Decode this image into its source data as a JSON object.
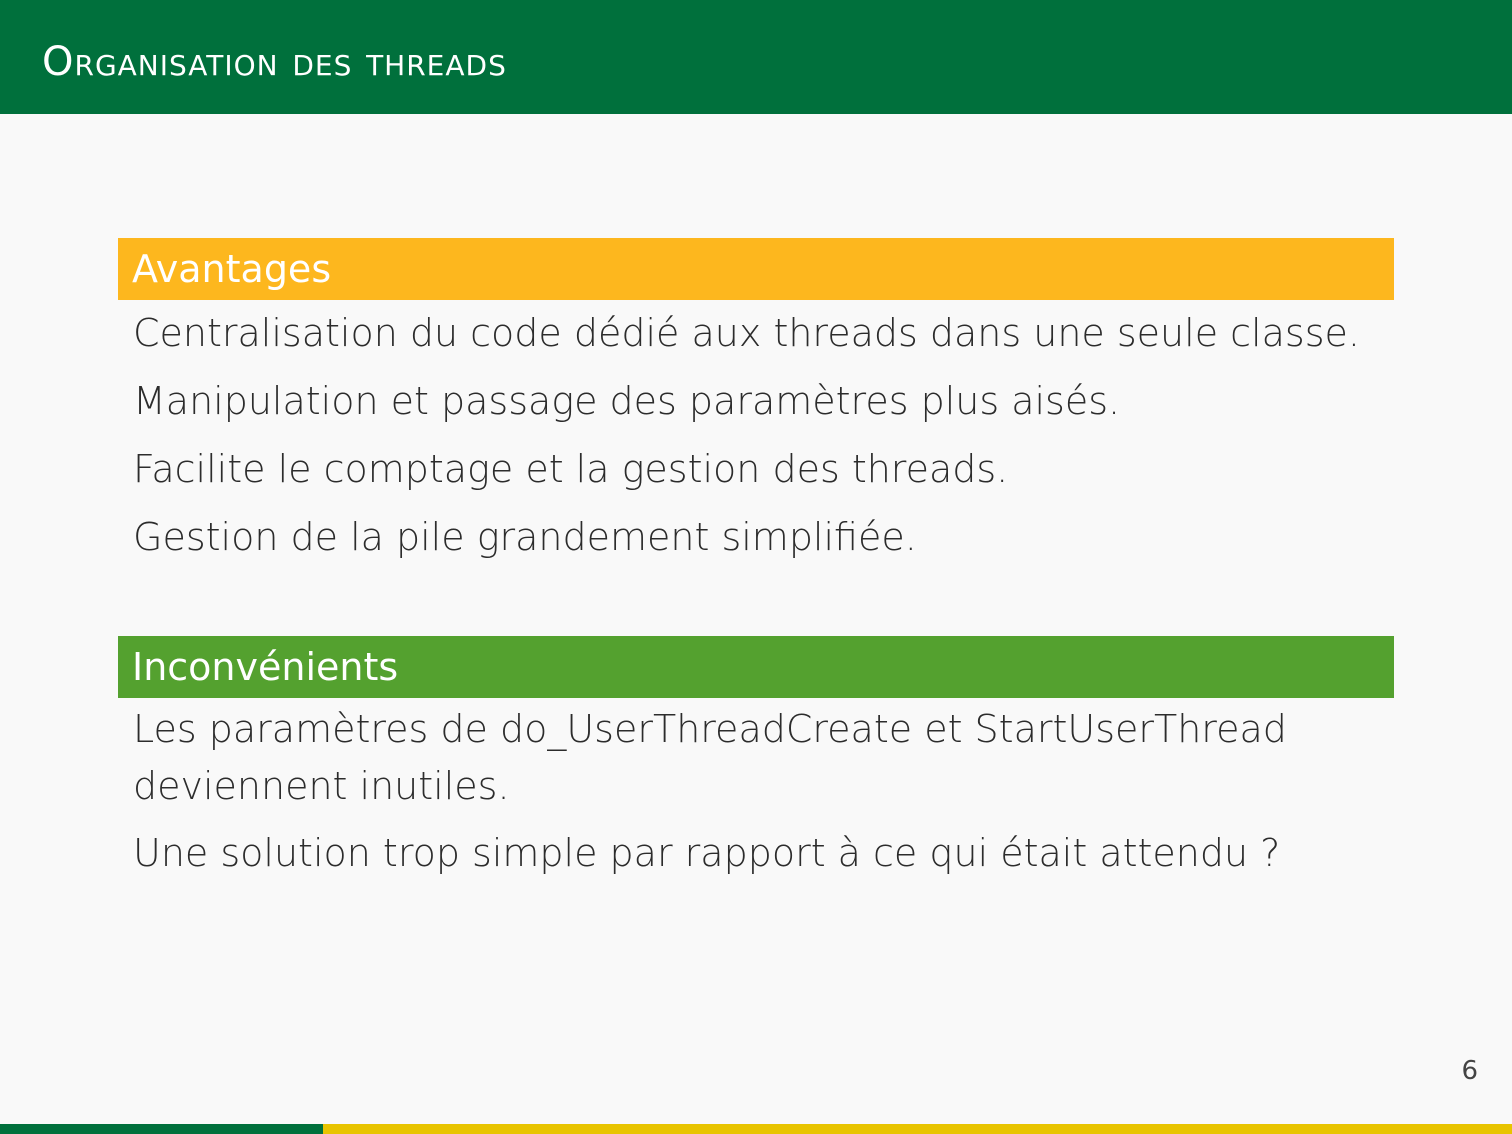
{
  "header": {
    "title": "Organisation des threads"
  },
  "advantages": {
    "title": "Avantages",
    "items": [
      "Centralisation du code dédié aux threads dans une seule classe.",
      "Manipulation et passage des paramètres plus aisés.",
      "Facilite le comptage et la gestion des threads.",
      "Gestion de la pile grandement simplifiée."
    ]
  },
  "disadvantages": {
    "title": "Inconvénients",
    "items": [
      "Les paramètres de do_UserThreadCreate et StartUserThread deviennent inutiles.",
      "Une solution trop simple par rapport à ce qui était attendu ?"
    ]
  },
  "footer": {
    "page_number": "6"
  },
  "colors": {
    "header_green": "#00703c",
    "advantages_yellow": "#fdb71e",
    "disadvantages_green": "#54a12f",
    "footer_yellow": "#e8c400",
    "background": "#f9f9f9"
  }
}
